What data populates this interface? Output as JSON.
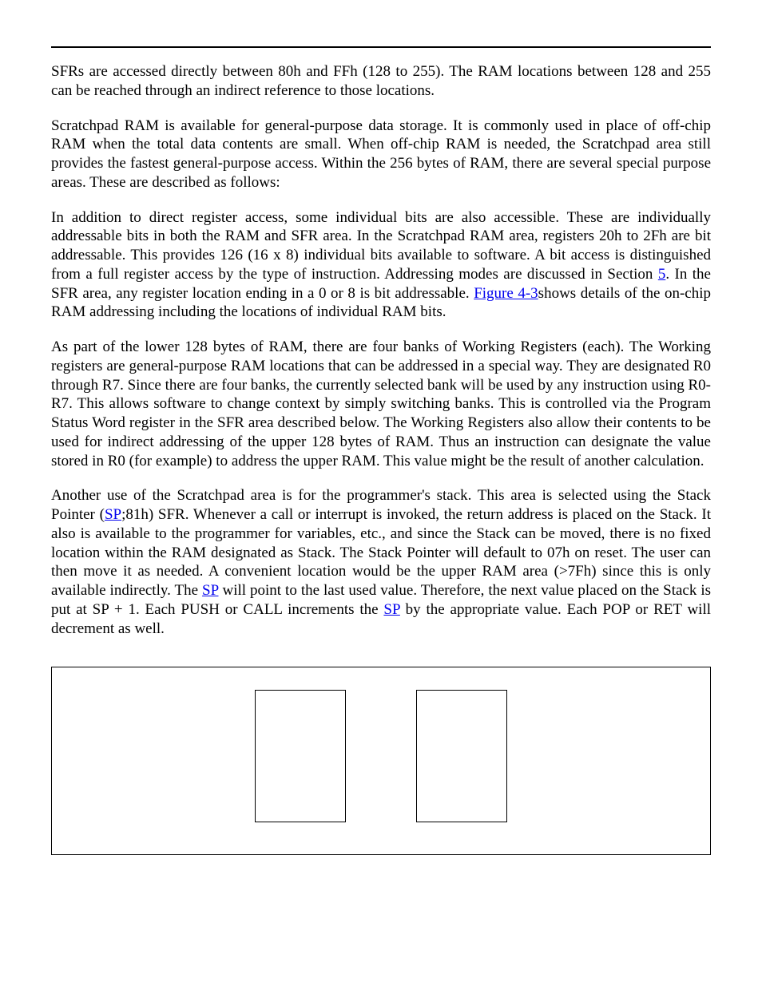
{
  "paragraphs": {
    "p1": "SFRs are accessed directly between 80h and FFh (128 to 255). The RAM locations between 128 and 255 can be reached through an indirect reference to those locations.",
    "p2": "Scratchpad RAM is available for general-purpose data storage. It is commonly used in place of off-chip RAM when the total data contents are small. When off-chip RAM is needed, the Scratchpad area still provides the fastest general-purpose access. Within the 256 bytes of RAM, there are several special purpose areas. These are described as follows:",
    "p3a": "In addition to direct register access, some individual bits are also accessible. These are individually addressable bits in both the RAM and SFR area. In the Scratchpad RAM area, registers 20h to 2Fh are bit addressable. This provides 126 (16 x 8) individual bits available to software. A bit access is distinguished from a full register access by the type of instruction. Addressing modes are discussed in Section ",
    "p3_link1": "5",
    "p3b": ". In the SFR area, any register location ending in a 0 or 8 is bit addressable. ",
    "p3_link2": "Figure 4-3",
    "p3c": "shows details of the on-chip RAM addressing including the locations of individual RAM bits.",
    "p4": "As part of the lower 128 bytes of RAM, there are four banks of Working Registers (each). The Working registers are general-purpose RAM locations that can be addressed in a special way. They are designated R0 through R7. Since there are four banks, the currently selected bank will be used by any instruction using R0-R7. This allows software to change context by simply switching banks. This is controlled via the Program Status Word register in the SFR area described below. The Working Registers also allow their contents to be used for indirect addressing of the upper 128 bytes of RAM. Thus an instruction can designate the value stored in R0 (for example) to address the upper RAM. This value might be the result of another calculation.",
    "p5a": "Another use of the Scratchpad area is for the programmer's stack. This area is selected using the Stack Pointer (",
    "p5_link1": "SP",
    "p5b": ";81h) SFR. Whenever a call or interrupt is invoked, the return address is placed on the Stack. It also is available to the programmer for variables, etc., and since the Stack can be moved, there is no fixed location within the RAM designated as Stack. The Stack Pointer will default to 07h on reset. The user can then move it as needed. A convenient location would be the upper RAM area (>7Fh) since this is only available indirectly. The ",
    "p5_link2": "SP",
    "p5c": " will point to the last used value. Therefore, the next value placed on the Stack is put at SP + 1. Each PUSH or CALL increments the ",
    "p5_link3": "SP",
    "p5d": " by the appropriate value. Each POP or RET will decrement as well."
  }
}
